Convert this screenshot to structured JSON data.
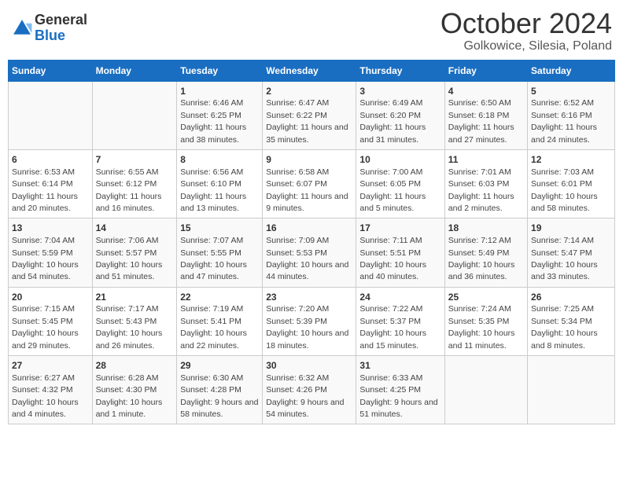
{
  "logo": {
    "text_general": "General",
    "text_blue": "Blue"
  },
  "title": "October 2024",
  "location": "Golkowice, Silesia, Poland",
  "days_of_week": [
    "Sunday",
    "Monday",
    "Tuesday",
    "Wednesday",
    "Thursday",
    "Friday",
    "Saturday"
  ],
  "weeks": [
    [
      {
        "day": "",
        "sunrise": "",
        "sunset": "",
        "daylight": ""
      },
      {
        "day": "",
        "sunrise": "",
        "sunset": "",
        "daylight": ""
      },
      {
        "day": "1",
        "sunrise": "Sunrise: 6:46 AM",
        "sunset": "Sunset: 6:25 PM",
        "daylight": "Daylight: 11 hours and 38 minutes."
      },
      {
        "day": "2",
        "sunrise": "Sunrise: 6:47 AM",
        "sunset": "Sunset: 6:22 PM",
        "daylight": "Daylight: 11 hours and 35 minutes."
      },
      {
        "day": "3",
        "sunrise": "Sunrise: 6:49 AM",
        "sunset": "Sunset: 6:20 PM",
        "daylight": "Daylight: 11 hours and 31 minutes."
      },
      {
        "day": "4",
        "sunrise": "Sunrise: 6:50 AM",
        "sunset": "Sunset: 6:18 PM",
        "daylight": "Daylight: 11 hours and 27 minutes."
      },
      {
        "day": "5",
        "sunrise": "Sunrise: 6:52 AM",
        "sunset": "Sunset: 6:16 PM",
        "daylight": "Daylight: 11 hours and 24 minutes."
      }
    ],
    [
      {
        "day": "6",
        "sunrise": "Sunrise: 6:53 AM",
        "sunset": "Sunset: 6:14 PM",
        "daylight": "Daylight: 11 hours and 20 minutes."
      },
      {
        "day": "7",
        "sunrise": "Sunrise: 6:55 AM",
        "sunset": "Sunset: 6:12 PM",
        "daylight": "Daylight: 11 hours and 16 minutes."
      },
      {
        "day": "8",
        "sunrise": "Sunrise: 6:56 AM",
        "sunset": "Sunset: 6:10 PM",
        "daylight": "Daylight: 11 hours and 13 minutes."
      },
      {
        "day": "9",
        "sunrise": "Sunrise: 6:58 AM",
        "sunset": "Sunset: 6:07 PM",
        "daylight": "Daylight: 11 hours and 9 minutes."
      },
      {
        "day": "10",
        "sunrise": "Sunrise: 7:00 AM",
        "sunset": "Sunset: 6:05 PM",
        "daylight": "Daylight: 11 hours and 5 minutes."
      },
      {
        "day": "11",
        "sunrise": "Sunrise: 7:01 AM",
        "sunset": "Sunset: 6:03 PM",
        "daylight": "Daylight: 11 hours and 2 minutes."
      },
      {
        "day": "12",
        "sunrise": "Sunrise: 7:03 AM",
        "sunset": "Sunset: 6:01 PM",
        "daylight": "Daylight: 10 hours and 58 minutes."
      }
    ],
    [
      {
        "day": "13",
        "sunrise": "Sunrise: 7:04 AM",
        "sunset": "Sunset: 5:59 PM",
        "daylight": "Daylight: 10 hours and 54 minutes."
      },
      {
        "day": "14",
        "sunrise": "Sunrise: 7:06 AM",
        "sunset": "Sunset: 5:57 PM",
        "daylight": "Daylight: 10 hours and 51 minutes."
      },
      {
        "day": "15",
        "sunrise": "Sunrise: 7:07 AM",
        "sunset": "Sunset: 5:55 PM",
        "daylight": "Daylight: 10 hours and 47 minutes."
      },
      {
        "day": "16",
        "sunrise": "Sunrise: 7:09 AM",
        "sunset": "Sunset: 5:53 PM",
        "daylight": "Daylight: 10 hours and 44 minutes."
      },
      {
        "day": "17",
        "sunrise": "Sunrise: 7:11 AM",
        "sunset": "Sunset: 5:51 PM",
        "daylight": "Daylight: 10 hours and 40 minutes."
      },
      {
        "day": "18",
        "sunrise": "Sunrise: 7:12 AM",
        "sunset": "Sunset: 5:49 PM",
        "daylight": "Daylight: 10 hours and 36 minutes."
      },
      {
        "day": "19",
        "sunrise": "Sunrise: 7:14 AM",
        "sunset": "Sunset: 5:47 PM",
        "daylight": "Daylight: 10 hours and 33 minutes."
      }
    ],
    [
      {
        "day": "20",
        "sunrise": "Sunrise: 7:15 AM",
        "sunset": "Sunset: 5:45 PM",
        "daylight": "Daylight: 10 hours and 29 minutes."
      },
      {
        "day": "21",
        "sunrise": "Sunrise: 7:17 AM",
        "sunset": "Sunset: 5:43 PM",
        "daylight": "Daylight: 10 hours and 26 minutes."
      },
      {
        "day": "22",
        "sunrise": "Sunrise: 7:19 AM",
        "sunset": "Sunset: 5:41 PM",
        "daylight": "Daylight: 10 hours and 22 minutes."
      },
      {
        "day": "23",
        "sunrise": "Sunrise: 7:20 AM",
        "sunset": "Sunset: 5:39 PM",
        "daylight": "Daylight: 10 hours and 18 minutes."
      },
      {
        "day": "24",
        "sunrise": "Sunrise: 7:22 AM",
        "sunset": "Sunset: 5:37 PM",
        "daylight": "Daylight: 10 hours and 15 minutes."
      },
      {
        "day": "25",
        "sunrise": "Sunrise: 7:24 AM",
        "sunset": "Sunset: 5:35 PM",
        "daylight": "Daylight: 10 hours and 11 minutes."
      },
      {
        "day": "26",
        "sunrise": "Sunrise: 7:25 AM",
        "sunset": "Sunset: 5:34 PM",
        "daylight": "Daylight: 10 hours and 8 minutes."
      }
    ],
    [
      {
        "day": "27",
        "sunrise": "Sunrise: 6:27 AM",
        "sunset": "Sunset: 4:32 PM",
        "daylight": "Daylight: 10 hours and 4 minutes."
      },
      {
        "day": "28",
        "sunrise": "Sunrise: 6:28 AM",
        "sunset": "Sunset: 4:30 PM",
        "daylight": "Daylight: 10 hours and 1 minute."
      },
      {
        "day": "29",
        "sunrise": "Sunrise: 6:30 AM",
        "sunset": "Sunset: 4:28 PM",
        "daylight": "Daylight: 9 hours and 58 minutes."
      },
      {
        "day": "30",
        "sunrise": "Sunrise: 6:32 AM",
        "sunset": "Sunset: 4:26 PM",
        "daylight": "Daylight: 9 hours and 54 minutes."
      },
      {
        "day": "31",
        "sunrise": "Sunrise: 6:33 AM",
        "sunset": "Sunset: 4:25 PM",
        "daylight": "Daylight: 9 hours and 51 minutes."
      },
      {
        "day": "",
        "sunrise": "",
        "sunset": "",
        "daylight": ""
      },
      {
        "day": "",
        "sunrise": "",
        "sunset": "",
        "daylight": ""
      }
    ]
  ]
}
